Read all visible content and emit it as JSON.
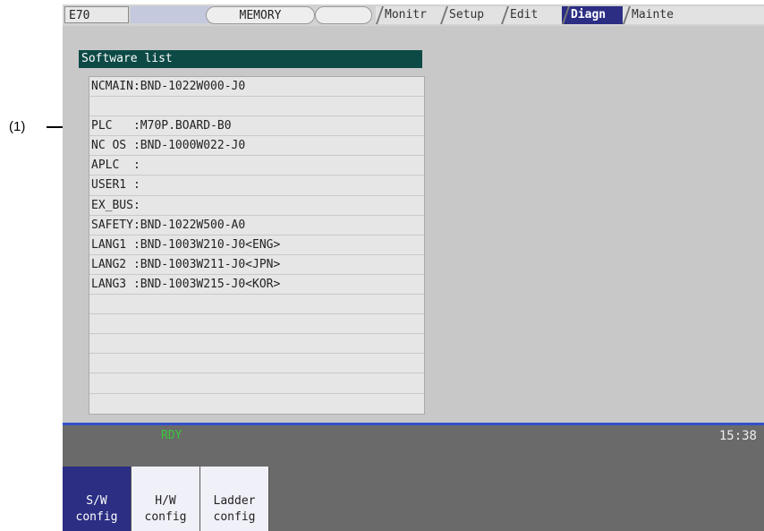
{
  "header": {
    "system_name": "E70",
    "mode": "MEMORY",
    "tabs": [
      "Monitr",
      "Setup",
      "Edit",
      "Diagn",
      "Mainte"
    ],
    "active_tab": "Diagn"
  },
  "panel": {
    "title": "Software list",
    "rows": [
      "NCMAIN:BND-1022W000-J0",
      "",
      "PLC   :M70P.BOARD-B0",
      "NC OS :BND-1000W022-J0",
      "APLC  :",
      "USER1 :",
      "EX_BUS:",
      "SAFETY:BND-1022W500-A0",
      "LANG1 :BND-1003W210-J0<ENG>",
      "LANG2 :BND-1003W211-J0<JPN>",
      "LANG3 :BND-1003W215-J0<KOR>",
      "",
      "",
      "",
      "",
      "",
      ""
    ]
  },
  "status": {
    "ready": "RDY",
    "clock": "15:38"
  },
  "menus": [
    {
      "line1": "S/W",
      "line2": "config",
      "active": true
    },
    {
      "line1": "H/W",
      "line2": "config",
      "active": false
    },
    {
      "line1": "Ladder",
      "line2": "config",
      "active": false
    }
  ],
  "annotation": "(1)",
  "colors": {
    "accent": "#2b2e83",
    "title_bar": "#0d4a46",
    "ready": "#39c839"
  }
}
